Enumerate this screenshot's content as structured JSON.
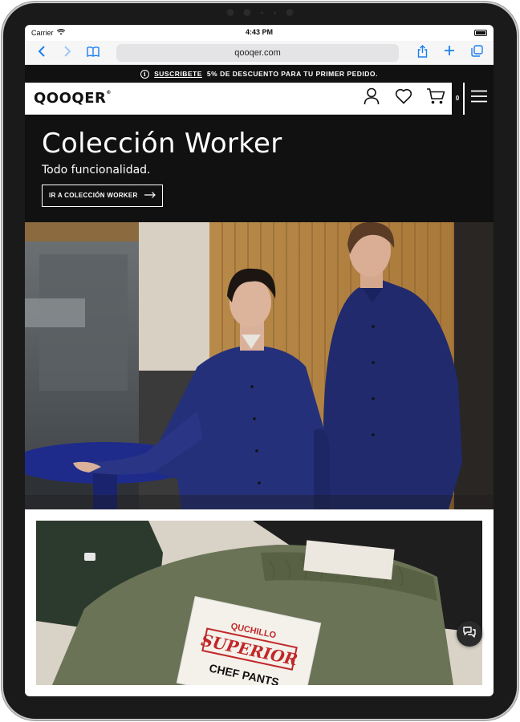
{
  "status_bar": {
    "carrier": "Carrier",
    "time": "4:43 PM"
  },
  "browser": {
    "url": "qooqer.com"
  },
  "promo": {
    "link_text": "SUSCRIBETE",
    "text": "5% DE DESCUENTO PARA TU PRIMER PEDIDO."
  },
  "header": {
    "logo": "QOOQER",
    "logo_mark": "®",
    "cart_count": "0"
  },
  "hero": {
    "title": "Colección Worker",
    "subtitle": "Todo funcionalidad.",
    "cta_label": "IR A COLECCIÓN WORKER"
  },
  "photo2": {
    "tag_brand": "QUCHILLO",
    "tag_title": "SUPERIOR",
    "tag_product": "CHEF PANTS"
  },
  "colors": {
    "accent_blue": "#1a7ff0",
    "dark": "#111111",
    "tag_red": "#c0282a"
  },
  "icons": [
    "wifi-icon",
    "battery-icon",
    "back-icon",
    "forward-icon",
    "bookmarks-icon",
    "share-icon",
    "new-tab-icon",
    "tabs-icon",
    "info-icon",
    "user-icon",
    "heart-icon",
    "cart-icon",
    "hamburger-icon",
    "chat-icon",
    "arrow-right-icon"
  ]
}
